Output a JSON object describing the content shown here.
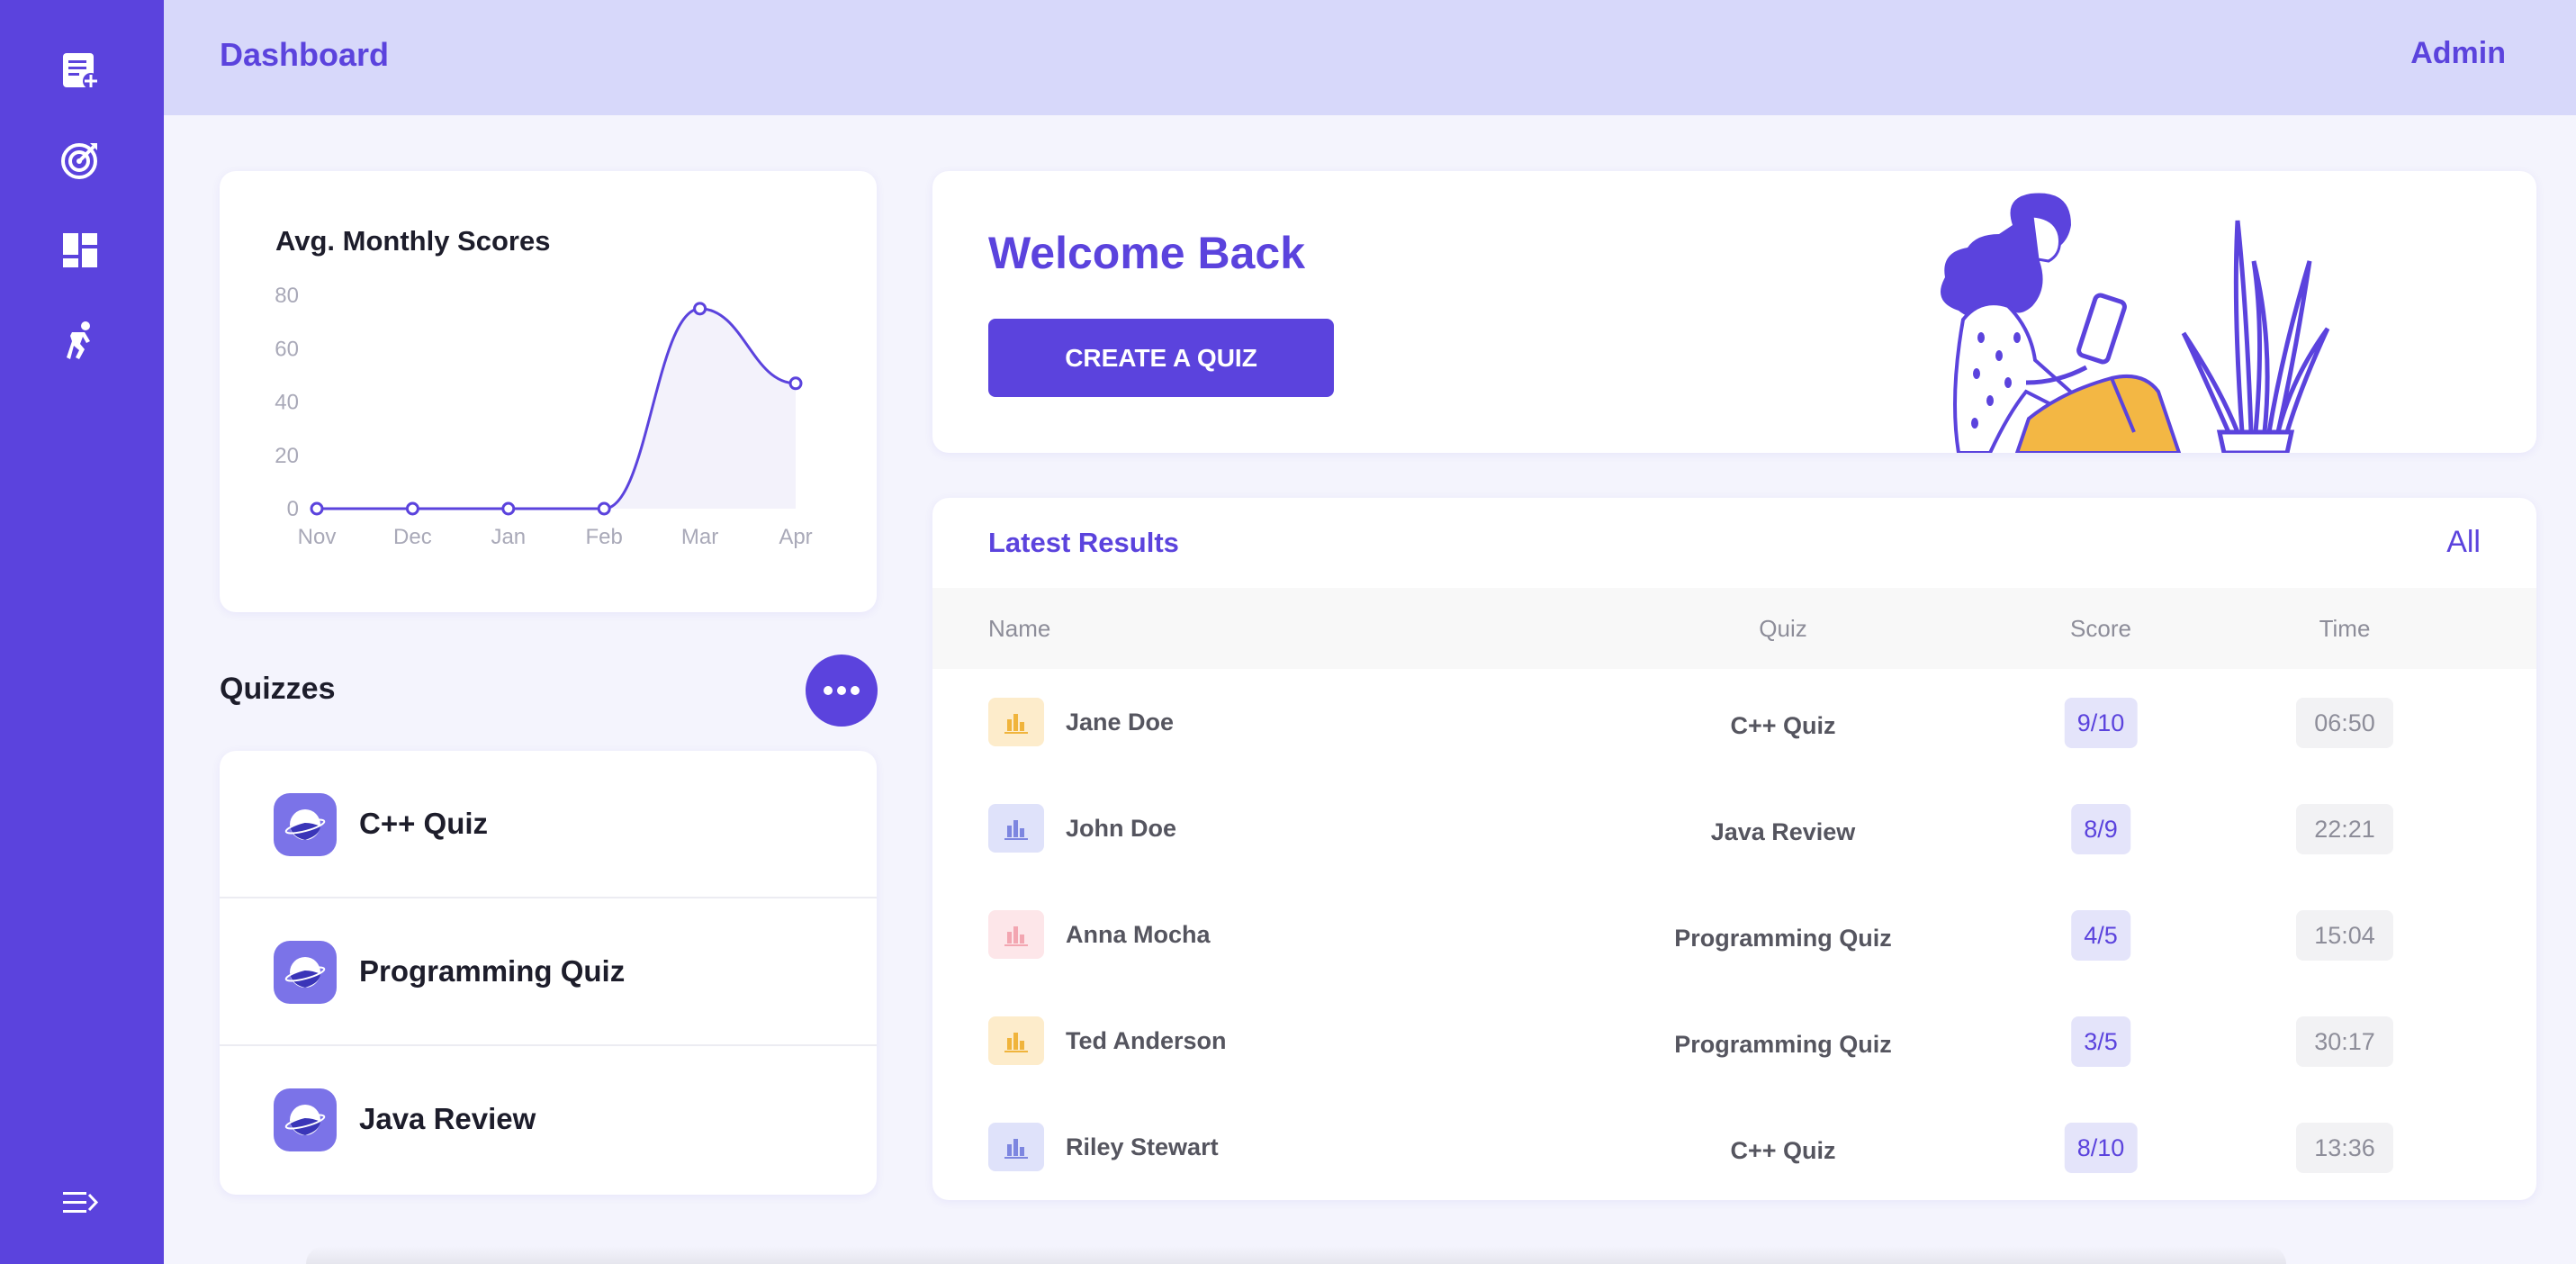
{
  "header": {
    "title": "Dashboard",
    "user": "Admin"
  },
  "sidebar": {
    "icons": [
      "new-quiz-icon",
      "target-icon",
      "dashboard-icon",
      "runner-icon"
    ],
    "collapse_icon": "collapse-menu-icon"
  },
  "chart_card": {
    "title": "Avg. Monthly Scores"
  },
  "chart_data": {
    "type": "area",
    "categories": [
      "Nov",
      "Dec",
      "Jan",
      "Feb",
      "Mar",
      "Apr"
    ],
    "values": [
      0,
      0,
      0,
      0,
      75,
      47
    ],
    "ylim": [
      0,
      80
    ],
    "yticks": [
      0,
      20,
      40,
      60,
      80
    ],
    "grid": false,
    "colors": {
      "line": "#5b43dd",
      "fill": "#f3f2fb"
    }
  },
  "quizzes": {
    "title": "Quizzes",
    "items": [
      {
        "label": "C++ Quiz"
      },
      {
        "label": "Programming Quiz"
      },
      {
        "label": "Java Review"
      }
    ]
  },
  "welcome": {
    "title": "Welcome Back",
    "button": "CREATE A QUIZ"
  },
  "results": {
    "title": "Latest Results",
    "all_link": "All",
    "columns": {
      "name": "Name",
      "quiz": "Quiz",
      "score": "Score",
      "time": "Time"
    },
    "rows": [
      {
        "name": "Jane Doe",
        "quiz": "C++ Quiz",
        "score": "9/10",
        "time": "06:50",
        "icon_color": "#f0b43c",
        "icon_bg": "#fdeccb"
      },
      {
        "name": "John Doe",
        "quiz": "Java Review",
        "score": "8/9",
        "time": "22:21",
        "icon_color": "#7d86e0",
        "icon_bg": "#dfe2fa"
      },
      {
        "name": "Anna Mocha",
        "quiz": "Programming Quiz",
        "score": "4/5",
        "time": "15:04",
        "icon_color": "#f3a6b1",
        "icon_bg": "#fde6e9"
      },
      {
        "name": "Ted Anderson",
        "quiz": "Programming Quiz",
        "score": "3/5",
        "time": "30:17",
        "icon_color": "#f0b43c",
        "icon_bg": "#fdeccb"
      },
      {
        "name": "Riley Stewart",
        "quiz": "C++ Quiz",
        "score": "8/10",
        "time": "13:36",
        "icon_color": "#7d86e0",
        "icon_bg": "#dfe2fa"
      }
    ]
  },
  "colors": {
    "accent": "#5b43dd",
    "topbar": "#d7d8fa",
    "background": "#f4f4fd"
  }
}
